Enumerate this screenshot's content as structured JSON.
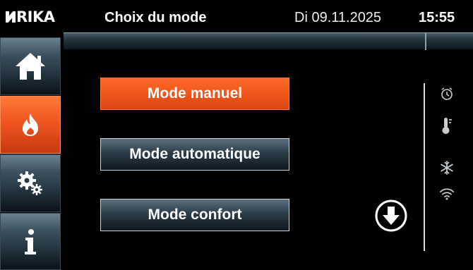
{
  "header": {
    "logo": "RIKA",
    "title": "Choix du mode",
    "date": "Di 09.11.2025",
    "time": "15:55"
  },
  "sidebar": {
    "items": [
      {
        "name": "home",
        "icon": "home-icon",
        "active": false
      },
      {
        "name": "flame",
        "icon": "flame-icon",
        "active": true
      },
      {
        "name": "settings",
        "icon": "gears-icon",
        "active": false
      },
      {
        "name": "info",
        "icon": "info-icon",
        "active": false
      }
    ]
  },
  "modes": {
    "manual": "Mode manuel",
    "automatic": "Mode automatique",
    "comfort": "Mode confort",
    "selected": "Mode manuel"
  },
  "status_icons": [
    "clock-icon",
    "thermometer-icon",
    "snowflake-icon",
    "wifi-icon"
  ],
  "colors": {
    "accent": "#ef5418",
    "button_dark": "#2b3d49",
    "background": "#000000"
  }
}
